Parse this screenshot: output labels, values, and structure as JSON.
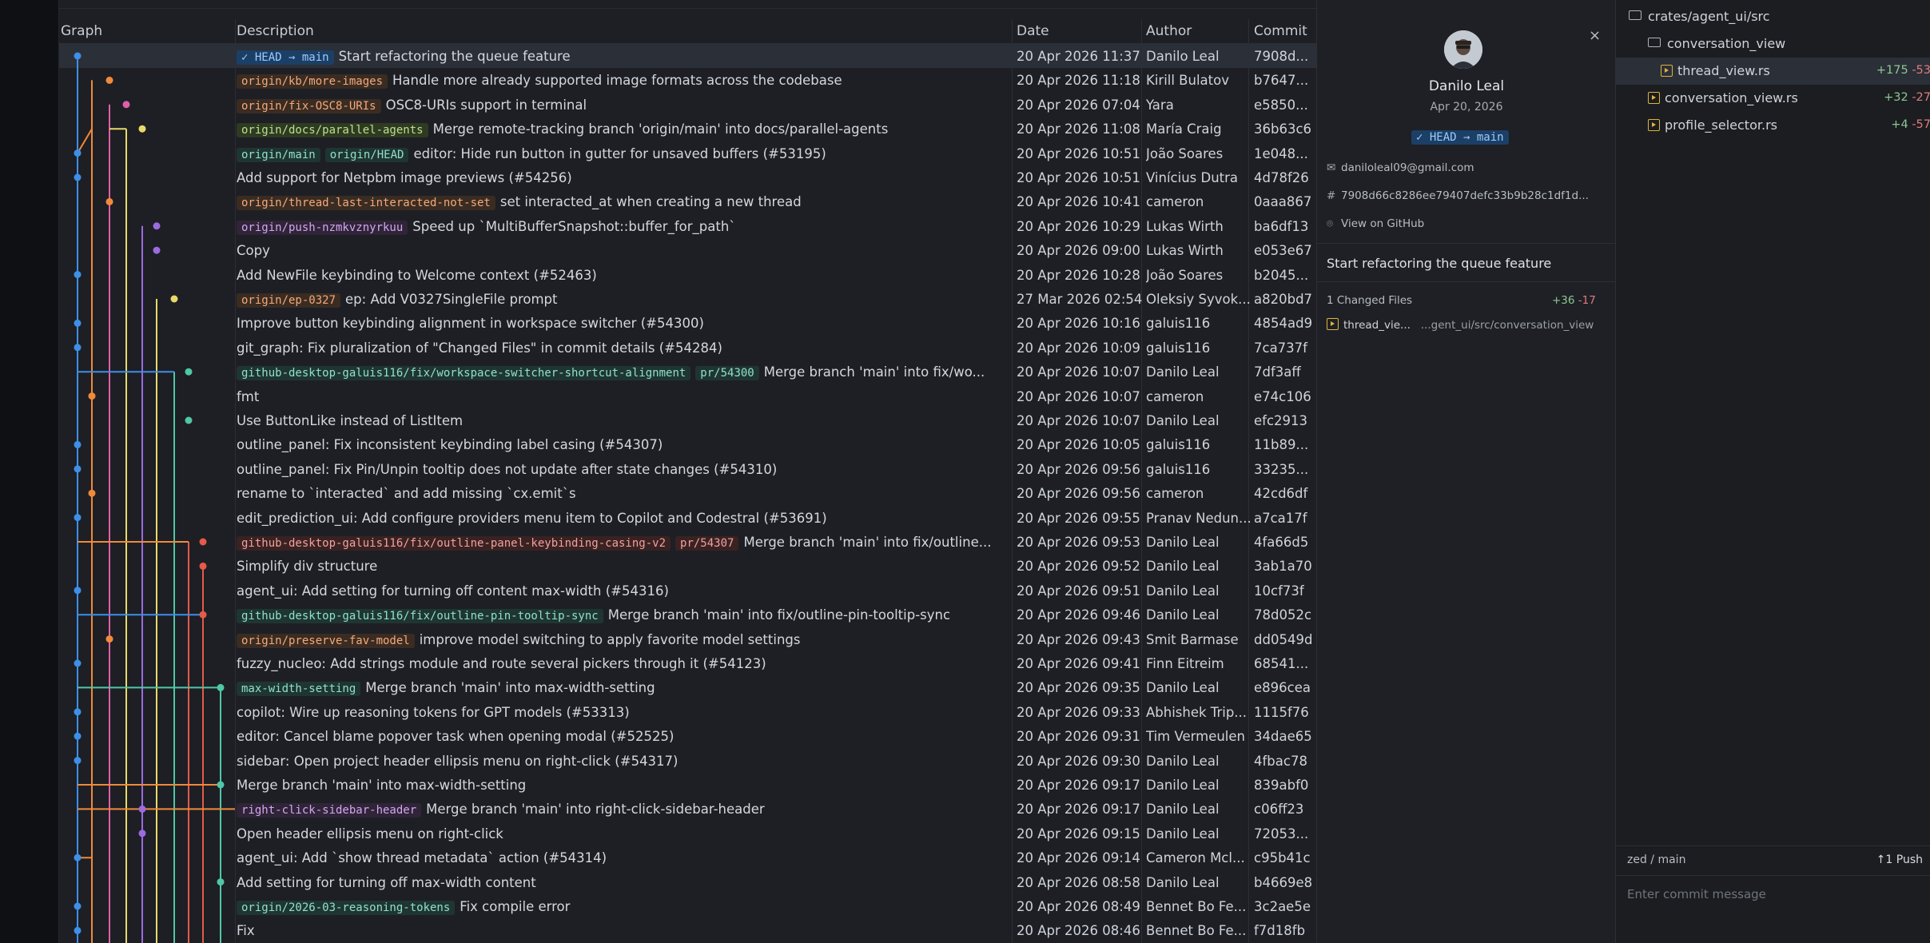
{
  "header": {
    "graph": "Graph",
    "description": "Description",
    "date": "Date",
    "author": "Author",
    "commit": "Commit"
  },
  "commits": [
    {
      "refs": [
        {
          "t": "✓ HEAD → main",
          "k": "head"
        }
      ],
      "msg": "Start refactoring the queue feature",
      "date": "20 Apr 2026 11:37",
      "author": "Danilo Leal",
      "hash": "7908d..."
    },
    {
      "refs": [
        {
          "t": "origin/kb/more-images",
          "k": "remote"
        }
      ],
      "msg": "Handle more already supported image formats across the codebase",
      "date": "20 Apr 2026 11:18",
      "author": "Kirill Bulatov",
      "hash": "b7647..."
    },
    {
      "refs": [
        {
          "t": "origin/fix-OSC8-URIs",
          "k": "remote"
        }
      ],
      "msg": "OSC8-URIs support in terminal",
      "date": "20 Apr 2026 07:04",
      "author": "Yara",
      "hash": "e5850..."
    },
    {
      "refs": [
        {
          "t": "origin/docs/parallel-agents",
          "k": "green"
        }
      ],
      "msg": "Merge remote-tracking branch 'origin/main' into docs/parallel-agents",
      "date": "20 Apr 2026 11:08",
      "author": "María Craig",
      "hash": "36b63c6"
    },
    {
      "refs": [
        {
          "t": "origin/main",
          "k": "branch"
        },
        {
          "t": "origin/HEAD",
          "k": "branch"
        }
      ],
      "msg": "editor: Hide run button in gutter for unsaved buffers (#53195)",
      "date": "20 Apr 2026 10:51",
      "author": "João Soares",
      "hash": "1e048..."
    },
    {
      "refs": [],
      "msg": "Add support for Netpbm image previews (#54256)",
      "date": "20 Apr 2026 10:51",
      "author": "Vinícius Dutra",
      "hash": "4d78f26"
    },
    {
      "refs": [
        {
          "t": "origin/thread-last-interacted-not-set",
          "k": "remote"
        }
      ],
      "msg": "set interacted_at when creating a new thread",
      "date": "20 Apr 2026 10:41",
      "author": "cameron",
      "hash": "0aaa867"
    },
    {
      "refs": [
        {
          "t": "origin/push-nzmkvznyrkuu",
          "k": "purple"
        }
      ],
      "msg": "Speed up `MultiBufferSnapshot::buffer_for_path`",
      "date": "20 Apr 2026 10:29",
      "author": "Lukas Wirth",
      "hash": "ba6df13"
    },
    {
      "refs": [],
      "msg": "Copy",
      "date": "20 Apr 2026 09:00",
      "author": "Lukas Wirth",
      "hash": "e053e67"
    },
    {
      "refs": [],
      "msg": "Add NewFile keybinding to Welcome context (#52463)",
      "date": "20 Apr 2026 10:28",
      "author": "João Soares",
      "hash": "b2045..."
    },
    {
      "refs": [
        {
          "t": "origin/ep-0327",
          "k": "remote"
        }
      ],
      "msg": "ep: Add V0327SingleFile prompt",
      "date": "27 Mar 2026 02:54",
      "author": "Oleksiy Syvok...",
      "hash": "a820bd7"
    },
    {
      "refs": [],
      "msg": "Improve button keybinding alignment in workspace switcher (#54300)",
      "date": "20 Apr 2026 10:16",
      "author": "galuis116",
      "hash": "4854ad9"
    },
    {
      "refs": [],
      "msg": "git_graph: Fix pluralization of \"Changed Files\" in commit details (#54284)",
      "date": "20 Apr 2026 10:09",
      "author": "galuis116",
      "hash": "7ca737f"
    },
    {
      "refs": [
        {
          "t": "github-desktop-galuis116/fix/workspace-switcher-shortcut-alignment",
          "k": "branch"
        },
        {
          "t": "pr/54300",
          "k": "branch"
        }
      ],
      "msg": "Merge branch 'main' into fix/wo...",
      "date": "20 Apr 2026 10:07",
      "author": "Danilo Leal",
      "hash": "7df3aff"
    },
    {
      "refs": [],
      "msg": "fmt",
      "date": "20 Apr 2026 10:07",
      "author": "cameron",
      "hash": "e74c106"
    },
    {
      "refs": [],
      "msg": "Use ButtonLike instead of ListItem",
      "date": "20 Apr 2026 10:07",
      "author": "Danilo Leal",
      "hash": "efc2913"
    },
    {
      "refs": [],
      "msg": "outline_panel: Fix inconsistent keybinding label casing (#54307)",
      "date": "20 Apr 2026 10:05",
      "author": "galuis116",
      "hash": "11b89..."
    },
    {
      "refs": [],
      "msg": "outline_panel: Fix Pin/Unpin tooltip does not update after state changes (#54310)",
      "date": "20 Apr 2026 09:56",
      "author": "galuis116",
      "hash": "33235..."
    },
    {
      "refs": [],
      "msg": "rename to `interacted` and add missing `cx.emit`s",
      "date": "20 Apr 2026 09:56",
      "author": "cameron",
      "hash": "42cd6df"
    },
    {
      "refs": [],
      "msg": "edit_prediction_ui: Add configure providers menu item to Copilot and Codestral (#53691)",
      "date": "20 Apr 2026 09:55",
      "author": "Pranav Nedun...",
      "hash": "a7ca17f"
    },
    {
      "refs": [
        {
          "t": "github-desktop-galuis116/fix/outline-panel-keybinding-casing-v2",
          "k": "pr"
        },
        {
          "t": "pr/54307",
          "k": "pr"
        }
      ],
      "msg": "Merge branch 'main' into fix/outline...",
      "date": "20 Apr 2026 09:53",
      "author": "Danilo Leal",
      "hash": "4fa66d5"
    },
    {
      "refs": [],
      "msg": "Simplify div structure",
      "date": "20 Apr 2026 09:52",
      "author": "Danilo Leal",
      "hash": "3ab1a70"
    },
    {
      "refs": [],
      "msg": "agent_ui: Add setting for turning off content max-width (#54316)",
      "date": "20 Apr 2026 09:51",
      "author": "Danilo Leal",
      "hash": "10cf73f"
    },
    {
      "refs": [
        {
          "t": "github-desktop-galuis116/fix/outline-pin-tooltip-sync",
          "k": "branch"
        }
      ],
      "msg": "Merge branch 'main' into fix/outline-pin-tooltip-sync",
      "date": "20 Apr 2026 09:46",
      "author": "Danilo Leal",
      "hash": "78d052c"
    },
    {
      "refs": [
        {
          "t": "origin/preserve-fav-model",
          "k": "remote"
        }
      ],
      "msg": "improve model switching to apply favorite model settings",
      "date": "20 Apr 2026 09:43",
      "author": "Smit Barmase",
      "hash": "dd0549d"
    },
    {
      "refs": [],
      "msg": "fuzzy_nucleo: Add strings module and route several pickers through it (#54123)",
      "date": "20 Apr 2026 09:41",
      "author": "Finn Eitreim",
      "hash": "68541..."
    },
    {
      "refs": [
        {
          "t": "max-width-setting",
          "k": "branch"
        }
      ],
      "msg": "Merge branch 'main' into max-width-setting",
      "date": "20 Apr 2026 09:35",
      "author": "Danilo Leal",
      "hash": "e896cea"
    },
    {
      "refs": [],
      "msg": "copilot: Wire up reasoning tokens for GPT models (#53313)",
      "date": "20 Apr 2026 09:33",
      "author": "Abhishek Trip...",
      "hash": "1115f76"
    },
    {
      "refs": [],
      "msg": "editor: Cancel blame popover task when opening modal (#52525)",
      "date": "20 Apr 2026 09:31",
      "author": "Tim Vermeulen",
      "hash": "34dae65"
    },
    {
      "refs": [],
      "msg": "sidebar: Open project header ellipsis menu on right-click (#54317)",
      "date": "20 Apr 2026 09:30",
      "author": "Danilo Leal",
      "hash": "4fbac78"
    },
    {
      "refs": [],
      "msg": "Merge branch 'main' into max-width-setting",
      "date": "20 Apr 2026 09:17",
      "author": "Danilo Leal",
      "hash": "839abf0"
    },
    {
      "refs": [
        {
          "t": "right-click-sidebar-header",
          "k": "purple"
        }
      ],
      "msg": "Merge branch 'main' into right-click-sidebar-header",
      "date": "20 Apr 2026 09:17",
      "author": "Danilo Leal",
      "hash": "c06ff23"
    },
    {
      "refs": [],
      "msg": "Open header ellipsis menu on right-click",
      "date": "20 Apr 2026 09:15",
      "author": "Danilo Leal",
      "hash": "72053..."
    },
    {
      "refs": [],
      "msg": "agent_ui: Add `show thread metadata` action (#54314)",
      "date": "20 Apr 2026 09:14",
      "author": "Cameron Mcl...",
      "hash": "c95b41c"
    },
    {
      "refs": [],
      "msg": "Add setting for turning off max-width content",
      "date": "20 Apr 2026 08:58",
      "author": "Danilo Leal",
      "hash": "b4669e8"
    },
    {
      "refs": [
        {
          "t": "origin/2026-03-reasoning-tokens",
          "k": "branch"
        }
      ],
      "msg": "Fix compile error",
      "date": "20 Apr 2026 08:49",
      "author": "Bennet Bo Fe...",
      "hash": "3c2ae5e"
    },
    {
      "refs": [],
      "msg": "Fix",
      "date": "20 Apr 2026 08:46",
      "author": "Bennet Bo Fe...",
      "hash": "f7d18fb"
    }
  ],
  "detail": {
    "name": "Danilo Leal",
    "date": "Apr 20, 2026",
    "head": "✓ HEAD → main",
    "email": "daniloleal09@gmail.com",
    "sha": "7908d66c8286ee79407defc33b9b28c1df1d...",
    "github": "View on GitHub",
    "message": "Start refactoring the queue feature",
    "changed": "1 Changed Files",
    "adds": "+36",
    "dels": "-17",
    "file_name": "thread_vie...",
    "file_path": "...gent_ui/src/conversation_view",
    "close": "×"
  },
  "changes": {
    "root": "crates/agent_ui/src",
    "folder": "conversation_view",
    "files": [
      {
        "name": "thread_view.rs",
        "add": "+175",
        "del": "-53"
      },
      {
        "name": "conversation_view.rs",
        "add": "+32",
        "del": "-27"
      },
      {
        "name": "profile_selector.rs",
        "add": "+4",
        "del": "-57"
      }
    ],
    "branch": "zed / main",
    "push": "↑1 Push",
    "commit_placeholder": "Enter commit message"
  },
  "colors": {
    "blue": "#3d8fe8",
    "orange": "#f08a3a",
    "pink": "#e05fa8",
    "yellow": "#e9d96a",
    "purple": "#9b6be0",
    "teal": "#4fc7a8",
    "red": "#e55a4a"
  }
}
